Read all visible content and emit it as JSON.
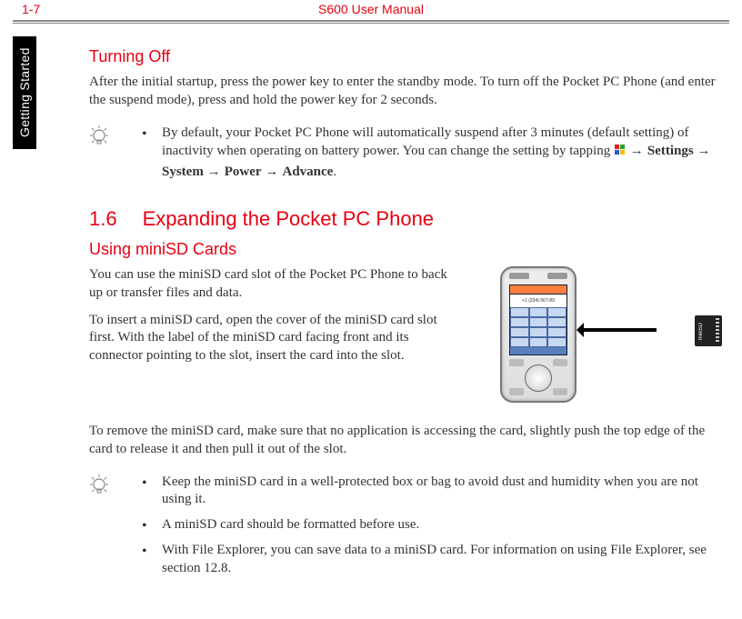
{
  "header": {
    "page_number": "1-7",
    "manual_title": "S600 User Manual"
  },
  "side_tab": "Getting Started",
  "turning_off": {
    "title": "Turning Off",
    "para": "After the initial startup, press the power key to enter the standby mode. To turn off the Pocket PC Phone (and enter the suspend mode), press and hold the power key for 2 seconds.",
    "tip_pre": "By default, your Pocket PC Phone will automatically suspend after 3 minutes (default setting) of inactivity when operating on battery power. You can change the setting by tapping ",
    "tip_path_arrow": " → ",
    "tip_path": [
      "Settings",
      "System",
      "Power",
      "Advance"
    ],
    "tip_post": "."
  },
  "section_1_6": {
    "number": "1.6",
    "title": "Expanding the Pocket PC Phone"
  },
  "minisd": {
    "title": "Using miniSD Cards",
    "para1": "You can use the miniSD card slot of the Pocket PC Phone to back up or transfer files and data.",
    "para2": "To insert a miniSD card, open the cover of the miniSD card slot first. With the label of the miniSD card facing front and its connector pointing to the slot, insert the card into the slot.",
    "para3": "To remove the miniSD card, make sure that no application is accessing the card, slightly push the top edge of the card to release it and then pull it out of the slot.",
    "tips": [
      "Keep the miniSD card in a well-protected box or bag to avoid dust and humidity when you are not using it.",
      "A miniSD card should be formatted before use.",
      "With File Explorer, you can save data to a miniSD card. For information on using File Explorer, see section 12.8."
    ],
    "phone_display_text": "+1 (234) 567-89"
  }
}
